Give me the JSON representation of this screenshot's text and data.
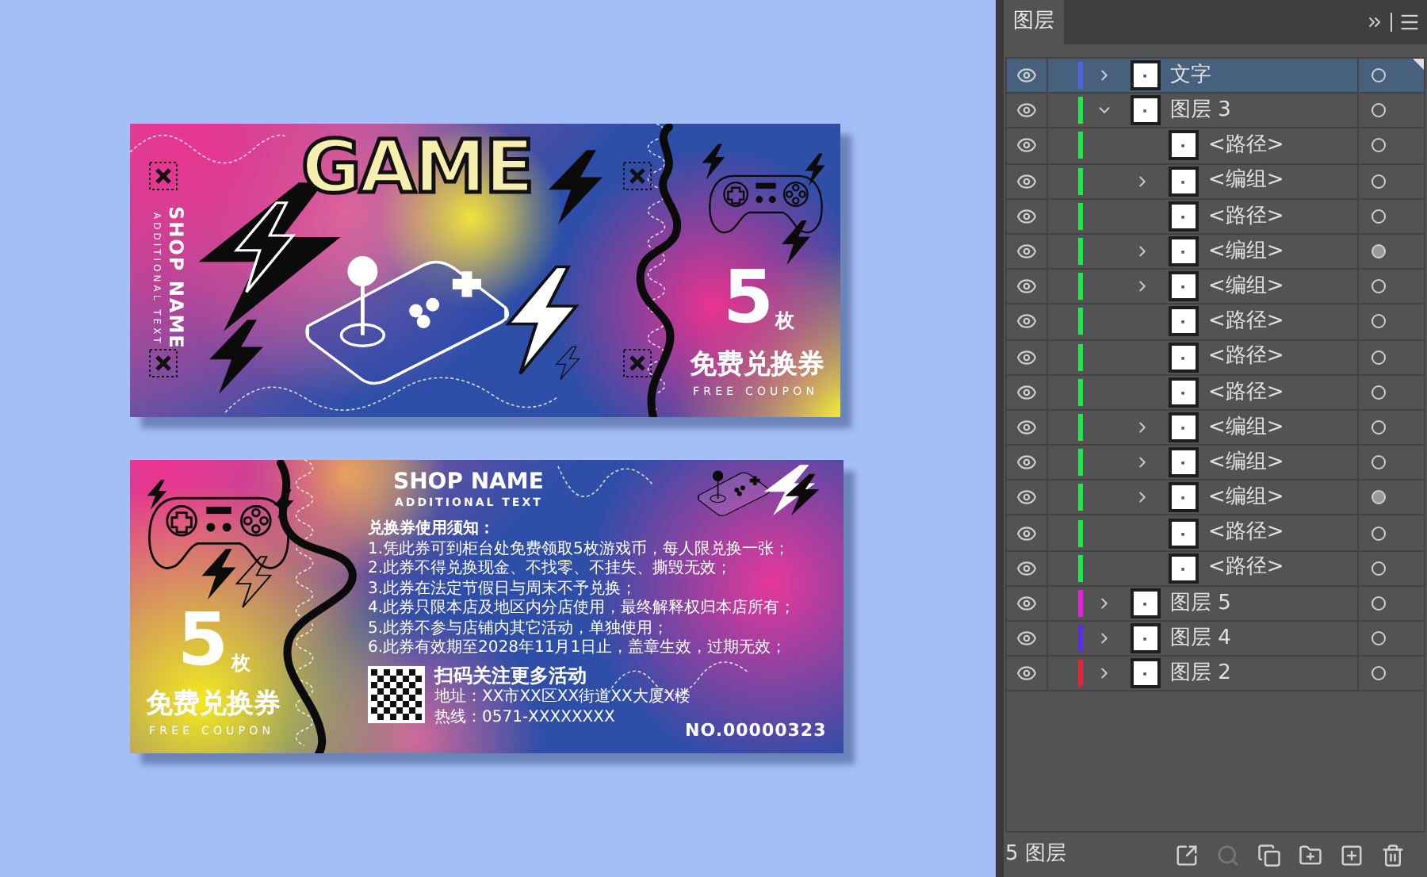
{
  "coupon_front": {
    "title": "GAME",
    "shop_name": "SHOP NAME",
    "additional_text": "ADDITIONAL TEXT",
    "count": "5",
    "unit": "枚",
    "label": "免费兑换券",
    "label_en": "FREE COUPON"
  },
  "coupon_back": {
    "shop_name": "SHOP NAME",
    "additional_text": "ADDITIONAL TEXT",
    "count": "5",
    "unit": "枚",
    "label": "免费兑换券",
    "label_en": "FREE COUPON",
    "rules_heading": "兑换券使用须知：",
    "rules": [
      "1.凭此券可到柜台处免费领取5枚游戏币，每人限兑换一张；",
      "2.此券不得兑换现金、不找零、不挂失、撕毁无效；",
      "3.此券在法定节假日与周末不予兑换；",
      "4.此券只限本店及地区内分店使用，最终解释权归本店所有；",
      "5.此券不参与店铺内其它活动，单独使用；",
      "6.此券有效期至2028年11月1日止，盖章生效，过期无效；"
    ],
    "qr_caption": "扫码关注更多活动",
    "address": "地址：XX市XX区XX街道XX大厦X楼",
    "hotline": "热线：0571-XXXXXXXX",
    "serial": "NO.00000323"
  },
  "layers_panel": {
    "tab": "图层",
    "footer": "5 图层",
    "layers": [
      {
        "name": "文字",
        "color": "#4f63e6",
        "selected": true,
        "expanded": false,
        "target_filled": false
      },
      {
        "name": "图层 3",
        "color": "#1ee84a",
        "selected": false,
        "expanded": true,
        "target_filled": false,
        "children": [
          {
            "name": "<路径>",
            "selected": false,
            "target_filled": false
          },
          {
            "name": "<编组>",
            "selected": false,
            "expanded": false,
            "target_filled": false
          },
          {
            "name": "<路径>",
            "selected": false,
            "target_filled": false
          },
          {
            "name": "<编组>",
            "selected": false,
            "expanded": false,
            "target_filled": true
          },
          {
            "name": "<编组>",
            "selected": false,
            "expanded": false,
            "target_filled": false
          },
          {
            "name": "<路径>",
            "selected": false,
            "target_filled": false
          },
          {
            "name": "<路径>",
            "selected": false,
            "target_filled": false
          },
          {
            "name": "<路径>",
            "selected": false,
            "target_filled": false
          },
          {
            "name": "<编组>",
            "selected": false,
            "expanded": false,
            "target_filled": false
          },
          {
            "name": "<编组>",
            "selected": false,
            "expanded": false,
            "target_filled": false
          },
          {
            "name": "<编组>",
            "selected": false,
            "expanded": false,
            "target_filled": true
          },
          {
            "name": "<路径>",
            "selected": false,
            "target_filled": false
          },
          {
            "name": "<路径>",
            "selected": false,
            "target_filled": false
          }
        ]
      },
      {
        "name": "图层 5",
        "color": "#e81ee0",
        "selected": false,
        "expanded": false,
        "target_filled": false
      },
      {
        "name": "图层 4",
        "color": "#5a2ee8",
        "selected": false,
        "expanded": false,
        "target_filled": false
      },
      {
        "name": "图层 2",
        "color": "#e8203a",
        "selected": false,
        "expanded": false,
        "target_filled": false
      }
    ]
  }
}
